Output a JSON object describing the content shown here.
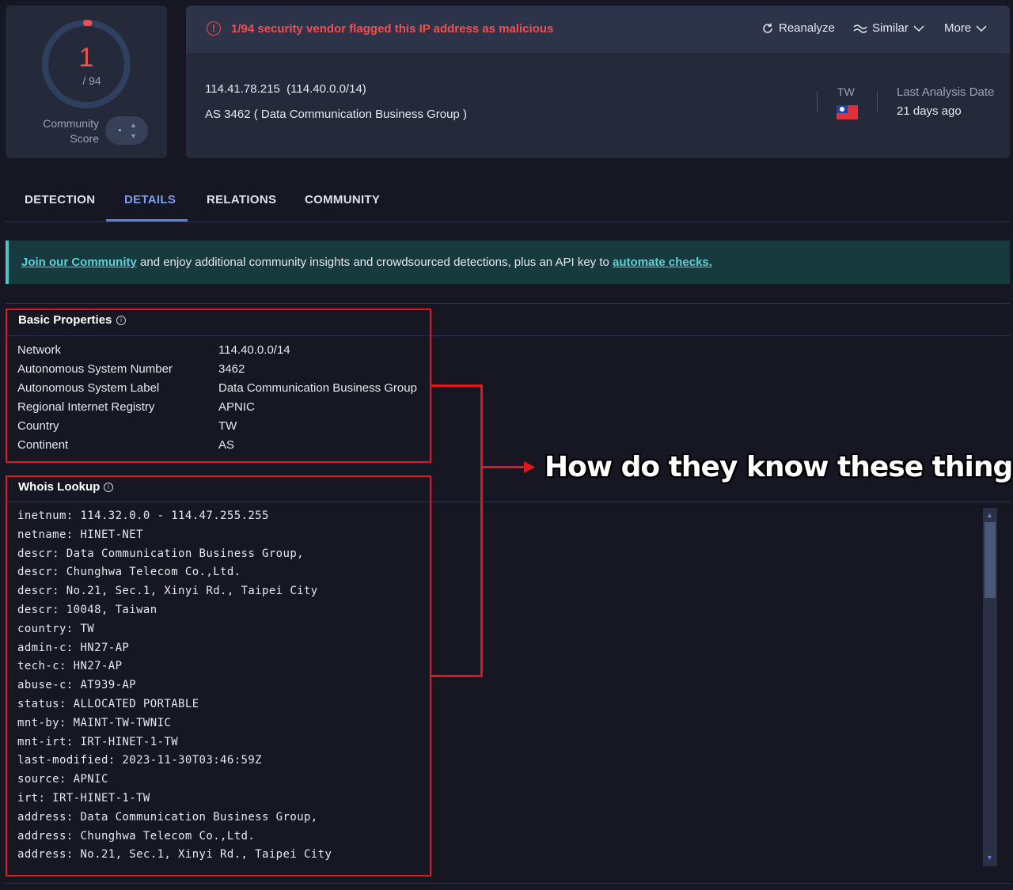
{
  "score": {
    "value": "1",
    "total": "/ 94",
    "label_line1": "Community",
    "label_line2": "Score",
    "detections": 1,
    "vendors": 94
  },
  "alert": {
    "text": "1/94 security vendor flagged this IP address as malicious",
    "icon": "alert-circle-icon",
    "color": "#ef4f4f"
  },
  "toolbar": {
    "reanalyze": "Reanalyze",
    "similar": "Similar",
    "more": "More"
  },
  "summary": {
    "ip": "114.41.78.215",
    "network": "(114.40.0.0/14)",
    "as_line": "AS 3462  ( Data Communication Business Group )",
    "country_code": "TW",
    "last_analysis_label": "Last Analysis Date",
    "last_analysis_value": "21 days ago"
  },
  "tabs": [
    {
      "label": "DETECTION",
      "active": false
    },
    {
      "label": "DETAILS",
      "active": true
    },
    {
      "label": "RELATIONS",
      "active": false
    },
    {
      "label": "COMMUNITY",
      "active": false
    }
  ],
  "banner": {
    "link1": "Join our Community",
    "middle": " and enjoy additional community insights and crowdsourced detections, plus an API key to ",
    "link2": "automate checks."
  },
  "basic_properties": {
    "title": "Basic Properties",
    "rows": [
      {
        "key": "Network",
        "value": "114.40.0.0/14"
      },
      {
        "key": "Autonomous System Number",
        "value": "3462"
      },
      {
        "key": "Autonomous System Label",
        "value": "Data Communication Business Group"
      },
      {
        "key": "Regional Internet Registry",
        "value": "APNIC"
      },
      {
        "key": "Country",
        "value": "TW"
      },
      {
        "key": "Continent",
        "value": "AS"
      }
    ]
  },
  "whois": {
    "title": "Whois Lookup",
    "lines": [
      "inetnum: 114.32.0.0 - 114.47.255.255",
      "netname: HINET-NET",
      "descr: Data Communication Business Group,",
      "descr: Chunghwa Telecom Co.,Ltd.",
      "descr: No.21, Sec.1, Xinyi Rd., Taipei City",
      "descr: 10048, Taiwan",
      "country: TW",
      "admin-c: HN27-AP",
      "tech-c: HN27-AP",
      "abuse-c: AT939-AP",
      "status: ALLOCATED PORTABLE",
      "mnt-by: MAINT-TW-TWNIC",
      "mnt-irt: IRT-HINET-1-TW",
      "last-modified: 2023-11-30T03:46:59Z",
      "source: APNIC",
      "irt: IRT-HINET-1-TW",
      "address: Data Communication Business Group,",
      "address: Chunghwa Telecom Co.,Ltd.",
      "address: No.21, Sec.1, Xinyi Rd., Taipei City"
    ]
  },
  "annotation": {
    "text": "How do they know these things?",
    "color": "#e1171e"
  },
  "colors": {
    "background": "#161722",
    "card": "#252a3a",
    "accent": "#5b7fe0",
    "danger": "#ef4f4f",
    "banner": "#173a3e",
    "banner_link": "#5fd0d4"
  }
}
